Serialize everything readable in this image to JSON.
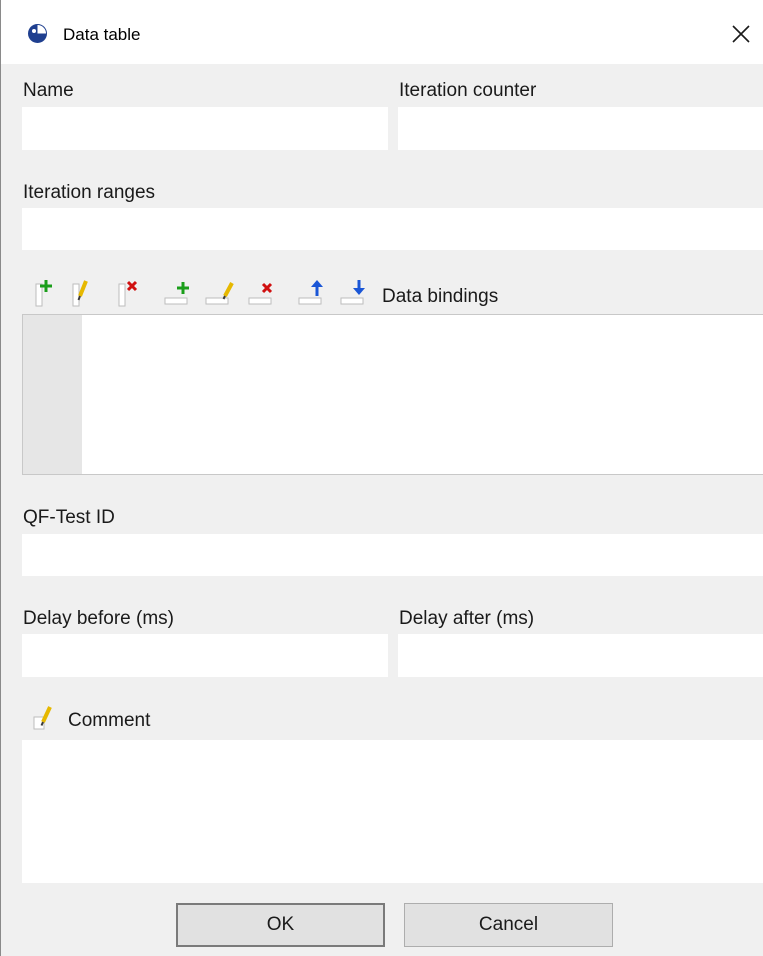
{
  "window": {
    "title": "Data table",
    "icons": {
      "app": "qftest-logo-icon",
      "close": "close-icon"
    }
  },
  "fields": {
    "name": {
      "label": "Name",
      "value": ""
    },
    "iteration_counter": {
      "label": "Iteration counter",
      "value": ""
    },
    "iteration_ranges": {
      "label": "Iteration ranges",
      "value": ""
    },
    "qftest_id": {
      "label": "QF-Test ID",
      "value": ""
    },
    "delay_before": {
      "label": "Delay before (ms)",
      "value": ""
    },
    "delay_after": {
      "label": "Delay after (ms)",
      "value": ""
    }
  },
  "data_bindings": {
    "label": "Data bindings",
    "toolbar": [
      {
        "name": "add-column-icon",
        "action": "add column",
        "color": "#1a9e1a"
      },
      {
        "name": "edit-column-icon",
        "action": "edit column",
        "color": "#e6b800"
      },
      {
        "name": "delete-column-icon",
        "action": "delete column",
        "color": "#d01010"
      },
      {
        "name": "add-row-icon",
        "action": "add row",
        "color": "#1a9e1a"
      },
      {
        "name": "edit-row-icon",
        "action": "edit row",
        "color": "#e6b800"
      },
      {
        "name": "delete-row-icon",
        "action": "delete row",
        "color": "#d01010"
      },
      {
        "name": "move-row-up-icon",
        "action": "move row up",
        "color": "#1a56d6"
      },
      {
        "name": "move-row-down-icon",
        "action": "move row down",
        "color": "#1a56d6"
      }
    ],
    "rows": []
  },
  "comment": {
    "label": "Comment",
    "value": "",
    "icon": "edit-comment-icon"
  },
  "buttons": {
    "ok": "OK",
    "cancel": "Cancel"
  }
}
